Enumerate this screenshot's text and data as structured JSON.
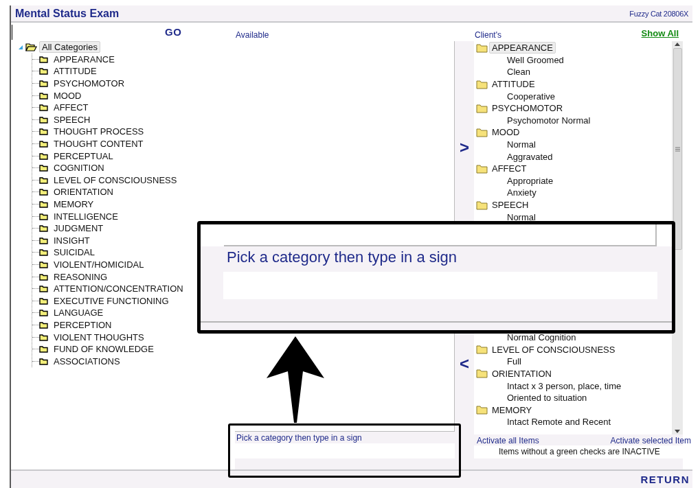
{
  "window": {
    "title": "Mental Status Exam",
    "user": "Fuzzy Cat 20806X"
  },
  "search": {
    "button": "GO"
  },
  "tree": {
    "root": {
      "label": "All Categories",
      "expanded": true,
      "selected": true,
      "children": [
        {
          "label": "APPEARANCE",
          "selected": false
        },
        {
          "label": "ATTITUDE",
          "selected": false
        },
        {
          "label": "PSYCHOMOTOR",
          "selected": false
        },
        {
          "label": "MOOD",
          "selected": false
        },
        {
          "label": "AFFECT",
          "selected": false
        },
        {
          "label": "SPEECH",
          "selected": false
        },
        {
          "label": "THOUGHT PROCESS",
          "selected": false
        },
        {
          "label": "THOUGHT CONTENT",
          "selected": false
        },
        {
          "label": "PERCEPTUAL",
          "selected": false
        },
        {
          "label": "COGNITION",
          "selected": false
        },
        {
          "label": "LEVEL OF CONSCIOUSNESS",
          "selected": false
        },
        {
          "label": "ORIENTATION",
          "selected": false
        },
        {
          "label": "MEMORY",
          "selected": false
        },
        {
          "label": "INTELLIGENCE",
          "selected": false
        },
        {
          "label": "JUDGMENT",
          "selected": false
        },
        {
          "label": "INSIGHT",
          "selected": false
        },
        {
          "label": "SUICIDAL",
          "selected": false
        },
        {
          "label": "VIOLENT/HOMICIDAL",
          "selected": false
        },
        {
          "label": "REASONING",
          "selected": false
        },
        {
          "label": "ATTENTION/CONCENTRATION",
          "selected": false
        },
        {
          "label": "EXECUTIVE FUNCTIONING",
          "selected": false
        },
        {
          "label": "LANGUAGE",
          "selected": false
        },
        {
          "label": "PERCEPTION",
          "selected": false
        },
        {
          "label": "VIOLENT THOUGHTS",
          "selected": false
        },
        {
          "label": "FUND OF KNOWLEDGE",
          "selected": false
        },
        {
          "label": "ASSOCIATIONS",
          "selected": false
        }
      ]
    }
  },
  "available": {
    "heading": "Available",
    "sign_label": "Pick a category then type in a sign"
  },
  "move_buttons": {
    "add": ">",
    "remove": "<"
  },
  "client": {
    "heading": "Client's",
    "show_all": "Show All",
    "items_top": [
      {
        "kind": "category",
        "label": "APPEARANCE",
        "selected": true
      },
      {
        "kind": "item",
        "label": "Well Groomed",
        "selected": false
      },
      {
        "kind": "item",
        "label": "Clean",
        "selected": false
      },
      {
        "kind": "category",
        "label": "ATTITUDE",
        "selected": false
      },
      {
        "kind": "item",
        "label": "Cooperative",
        "selected": false
      },
      {
        "kind": "category",
        "label": "PSYCHOMOTOR",
        "selected": false
      },
      {
        "kind": "item",
        "label": "Psychomotor Normal",
        "selected": false
      },
      {
        "kind": "category",
        "label": "MOOD",
        "selected": false
      },
      {
        "kind": "item",
        "label": "Normal",
        "selected": false
      },
      {
        "kind": "item",
        "label": "Aggravated",
        "selected": false
      },
      {
        "kind": "category",
        "label": "AFFECT",
        "selected": false
      },
      {
        "kind": "item",
        "label": "Appropriate",
        "selected": false
      },
      {
        "kind": "item",
        "label": "Anxiety",
        "selected": false
      },
      {
        "kind": "category",
        "label": "SPEECH",
        "selected": false
      },
      {
        "kind": "item",
        "label": "Normal",
        "selected": false
      }
    ],
    "items_bottom": [
      {
        "kind": "item",
        "label": "Normal Cognition",
        "selected": false
      },
      {
        "kind": "category",
        "label": "LEVEL OF CONSCIOUSNESS",
        "selected": false
      },
      {
        "kind": "item",
        "label": "Full",
        "selected": false
      },
      {
        "kind": "category",
        "label": "ORIENTATION",
        "selected": false
      },
      {
        "kind": "item",
        "label": "Intact x 3 person, place, time",
        "selected": false
      },
      {
        "kind": "item",
        "label": "Oriented to situation",
        "selected": false
      },
      {
        "kind": "category",
        "label": "MEMORY",
        "selected": false
      },
      {
        "kind": "item",
        "label": "Intact Remote and Recent",
        "selected": false
      }
    ],
    "activate_all": "Activate all Items",
    "activate_selected": "Activate selected Item",
    "note": "Items without a green checks are INACTIVE"
  },
  "return_button": "RETURN",
  "annotation": {
    "magnified_label": "Pick a category then type in a sign"
  }
}
